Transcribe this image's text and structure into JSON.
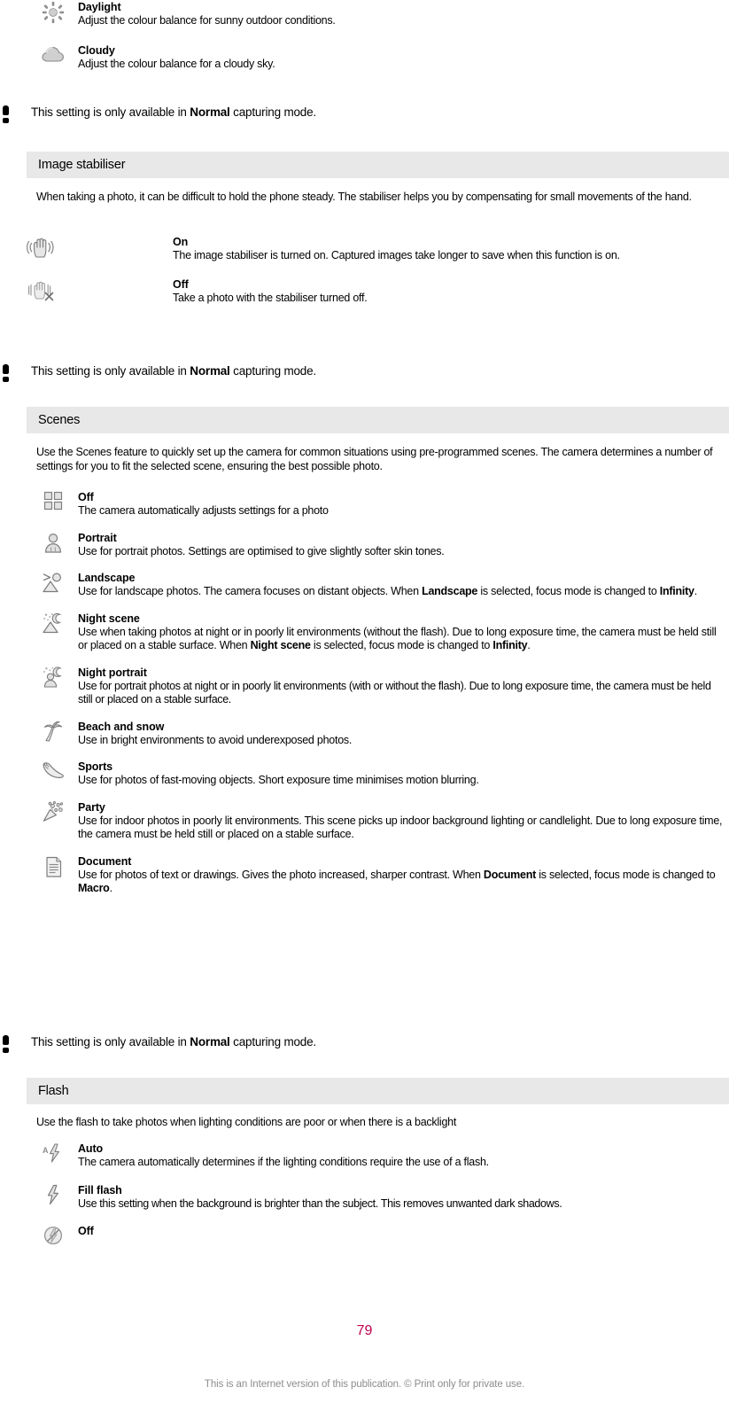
{
  "page": {
    "number": "79",
    "footer": "This is an Internet version of this publication. © Print only for private use.",
    "page_number_color": "#c2004f"
  },
  "white_balance_entries": [
    {
      "icon": "sun-icon",
      "title": "Daylight",
      "desc": "Adjust the colour balance for sunny outdoor conditions."
    },
    {
      "icon": "cloud-icon",
      "title": "Cloudy",
      "desc": "Adjust the colour balance for a cloudy sky."
    }
  ],
  "notes": {
    "white_balance": {
      "pre": "This setting is only available in ",
      "bold": "Normal",
      "post": " capturing mode."
    },
    "stabiliser": {
      "pre": "This setting is only available in ",
      "bold": "Normal",
      "post": " capturing mode."
    },
    "scenes": {
      "pre": "This setting is only available in ",
      "bold": "Normal",
      "post": " capturing mode."
    }
  },
  "sections": {
    "image_stabiliser": {
      "heading": "Image stabiliser",
      "intro": "When taking a photo, it can be difficult to hold the phone steady. The stabiliser helps you by compensating for small movements of the hand.",
      "entries": [
        {
          "icon": "hand-steady-icon",
          "title": "On",
          "desc": "The image stabiliser is turned on. Captured images take longer to save when this function is on."
        },
        {
          "icon": "hand-shaky-icon",
          "title": "Off",
          "desc": "Take a photo with the stabiliser turned off."
        }
      ]
    },
    "scenes": {
      "heading": "Scenes",
      "intro": "Use the Scenes feature to quickly set up the camera for common situations using pre-programmed scenes. The camera determines a number of settings for you to fit the selected scene, ensuring the best possible photo.",
      "entries": [
        {
          "icon": "grid-squares-icon",
          "title": "Off",
          "desc_parts": [
            {
              "text": "The camera automatically adjusts settings for a photo",
              "bold": false
            }
          ]
        },
        {
          "icon": "portrait-person-icon",
          "title": "Portrait",
          "desc_parts": [
            {
              "text": "Use for portrait photos. Settings are optimised to give slightly softer skin tones.",
              "bold": false
            }
          ]
        },
        {
          "icon": "landscape-mountain-icon",
          "title": "Landscape",
          "desc_parts": [
            {
              "text": "Use for landscape photos. The camera focuses on distant objects. When ",
              "bold": false
            },
            {
              "text": "Landscape",
              "bold": true
            },
            {
              "text": " is selected, focus mode is changed to ",
              "bold": false
            },
            {
              "text": "Infinity",
              "bold": true
            },
            {
              "text": ".",
              "bold": false
            }
          ]
        },
        {
          "icon": "night-scene-icon",
          "title": "Night scene",
          "desc_parts": [
            {
              "text": "Use when taking photos at night or in poorly lit environments (without the flash). Due to long exposure time, the camera must be held still or placed on a stable surface. When ",
              "bold": false
            },
            {
              "text": "Night scene",
              "bold": true
            },
            {
              "text": " is selected, focus mode is changed to ",
              "bold": false
            },
            {
              "text": "Infinity",
              "bold": true
            },
            {
              "text": ".",
              "bold": false
            }
          ]
        },
        {
          "icon": "night-portrait-icon",
          "title": "Night portrait",
          "desc_parts": [
            {
              "text": "Use for portrait photos at night or in poorly lit environments (with or without the flash). Due to long exposure time, the camera must be held still or placed on a stable surface.",
              "bold": false
            }
          ]
        },
        {
          "icon": "beach-palm-icon",
          "title": "Beach and snow",
          "desc_parts": [
            {
              "text": "Use in bright environments to avoid underexposed photos.",
              "bold": false
            }
          ]
        },
        {
          "icon": "sports-shoe-icon",
          "title": "Sports",
          "desc_parts": [
            {
              "text": "Use for photos of fast-moving objects. Short exposure time minimises motion blurring.",
              "bold": false
            }
          ]
        },
        {
          "icon": "party-popper-icon",
          "title": "Party",
          "desc_parts": [
            {
              "text": "Use for indoor photos in poorly lit environments. This scene picks up indoor background lighting or candlelight. Due to long exposure time, the camera must be held still or placed on a stable surface.",
              "bold": false
            }
          ]
        },
        {
          "icon": "document-page-icon",
          "title": "Document",
          "desc_parts": [
            {
              "text": "Use for photos of text or drawings. Gives the photo increased, sharper contrast. When ",
              "bold": false
            },
            {
              "text": "Document",
              "bold": true
            },
            {
              "text": " is selected, focus mode is changed to ",
              "bold": false
            },
            {
              "text": "Macro",
              "bold": true
            },
            {
              "text": ".",
              "bold": false
            }
          ]
        }
      ]
    },
    "flash": {
      "heading": "Flash",
      "intro": "Use the flash to take photos when lighting conditions are poor or when there is a backlight",
      "entries": [
        {
          "icon": "flash-auto-icon",
          "title": "Auto",
          "desc": "The camera automatically determines if the lighting conditions require the use of a flash."
        },
        {
          "icon": "flash-fill-icon",
          "title": "Fill flash",
          "desc": "Use this setting when the background is brighter than the subject. This removes unwanted dark shadows."
        },
        {
          "icon": "flash-off-icon",
          "title": "Off",
          "desc": ""
        }
      ]
    }
  }
}
